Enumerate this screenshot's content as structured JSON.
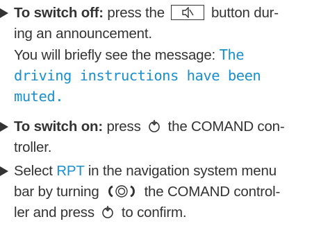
{
  "steps": [
    {
      "switch_off": {
        "label": "To switch off:",
        "text_a": "press the",
        "key_icon": "mute-speaker-icon",
        "text_b": "button dur-",
        "line2": "ing an announcement.",
        "line3": "You will briefly see the message:",
        "msg_part1": "The",
        "msg_line2": "driving instructions have been",
        "msg_line3": "muted."
      }
    },
    {
      "switch_on": {
        "label": "To switch on:",
        "text_a": "press",
        "push_icon": "press-controller-icon",
        "text_b": "the COMAND con-",
        "line2": "troller."
      }
    },
    {
      "select_rpt": {
        "text_a": "Select",
        "rpt": "RPT",
        "text_b": "in the navigation system menu",
        "line2_a": "bar by turning",
        "turn_icon": "turn-controller-icon",
        "line2_b": "the COMAND control-",
        "line3_a": "ler and press",
        "push_icon": "press-controller-icon",
        "line3_b": "to confirm."
      }
    }
  ],
  "colors": {
    "text": "#333333",
    "accent_blue": "#1a8fd0"
  }
}
